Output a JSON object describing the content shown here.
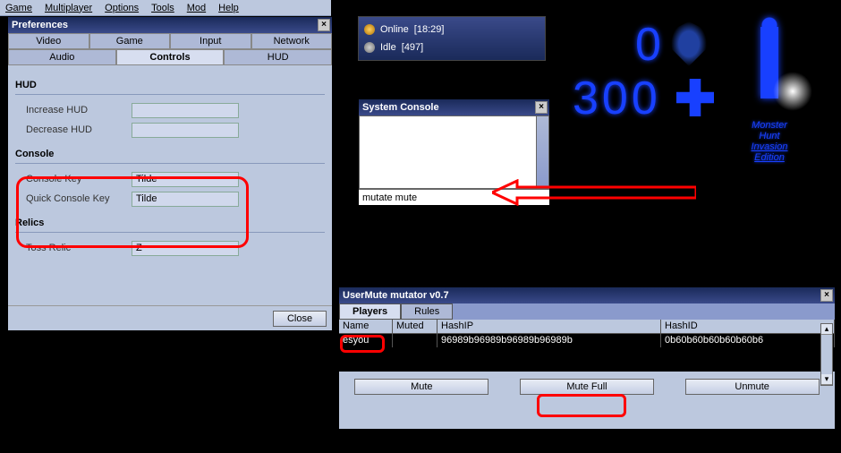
{
  "menubar": [
    "Game",
    "Multiplayer",
    "Options",
    "Tools",
    "Mod",
    "Help"
  ],
  "prefs": {
    "title": "Preferences",
    "tabs_row1": [
      "Video",
      "Game",
      "Input",
      "Network"
    ],
    "tabs_row2": [
      "Audio",
      "Controls",
      "HUD"
    ],
    "active_tab": "Controls",
    "groups": {
      "hud": {
        "title": "HUD",
        "rows": [
          {
            "label": "Increase HUD",
            "value": ""
          },
          {
            "label": "Decrease HUD",
            "value": ""
          }
        ]
      },
      "console": {
        "title": "Console",
        "rows": [
          {
            "label": "Console Key",
            "value": "Tilde"
          },
          {
            "label": "Quick Console Key",
            "value": "Tilde"
          }
        ]
      },
      "relics": {
        "title": "Relics",
        "rows": [
          {
            "label": "Toss Relic",
            "value": "Z"
          }
        ]
      }
    },
    "close": "Close"
  },
  "net": {
    "online_label": "Online",
    "online_count": "18:29",
    "idle_label": "Idle",
    "idle_count": "497"
  },
  "syscon": {
    "title": "System Console",
    "input": "mutate mute"
  },
  "hud": {
    "armor": "0",
    "health": "300"
  },
  "figure": {
    "l1": "Monster",
    "l2": "Hunt",
    "l3": "Invasion",
    "l4": "Edition"
  },
  "usermute": {
    "title": "UserMute mutator v0.7",
    "tabs": [
      "Players",
      "Rules"
    ],
    "active_tab": "Players",
    "columns": [
      "Name",
      "Muted",
      "HashIP",
      "HashID"
    ],
    "rows": [
      {
        "name": "esyou",
        "muted": "",
        "haship": "96989b96989b96989b96989b",
        "hashid": "0b60b60b60b60b60b6"
      }
    ],
    "buttons": [
      "Mute",
      "Mute Full",
      "Unmute"
    ]
  }
}
